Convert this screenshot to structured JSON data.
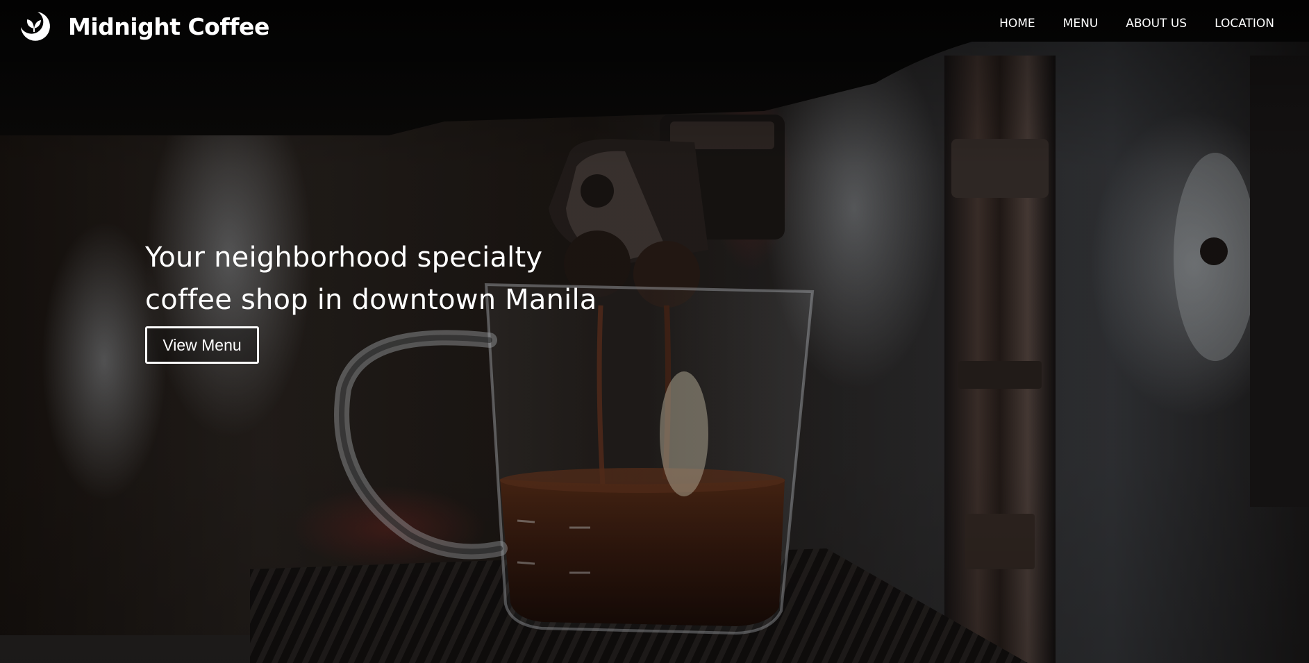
{
  "brand": {
    "name": "Midnight Coffee",
    "logo_icon": "crescent-moon-leaf-icon"
  },
  "nav": {
    "items": [
      {
        "label": "HOME"
      },
      {
        "label": "MENU"
      },
      {
        "label": "ABOUT US"
      },
      {
        "label": "LOCATION"
      }
    ]
  },
  "hero": {
    "headline_line1": "Your neighborhood specialty",
    "headline_line2": "coffee shop in downtown Manila",
    "cta_label": "View Menu",
    "background_image": "espresso-pouring-into-glass-cup"
  },
  "colors": {
    "text": "#ffffff",
    "background_dark": "#0c0907",
    "coffee": "#3a1c10"
  }
}
